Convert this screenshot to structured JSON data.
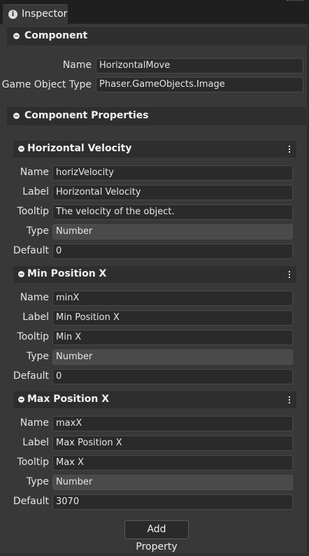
{
  "tab": {
    "label": "Inspector",
    "icon": "info-icon"
  },
  "component": {
    "title": "Component",
    "name_label": "Name",
    "name_value": "HorizontalMove",
    "type_label": "Game Object Type",
    "type_value": "Phaser.GameObjects.Image"
  },
  "properties_section": {
    "title": "Component Properties"
  },
  "properties": [
    {
      "title": "Horizontal Velocity",
      "fields": [
        {
          "label": "Name",
          "value": "horizVelocity"
        },
        {
          "label": "Label",
          "value": "Horizontal Velocity"
        },
        {
          "label": "Tooltip",
          "value": "The velocity of the object."
        },
        {
          "label": "Type",
          "value": "Number"
        },
        {
          "label": "Default",
          "value": "0"
        }
      ]
    },
    {
      "title": "Min Position X",
      "fields": [
        {
          "label": "Name",
          "value": "minX"
        },
        {
          "label": "Label",
          "value": "Min Position X"
        },
        {
          "label": "Tooltip",
          "value": "Min X"
        },
        {
          "label": "Type",
          "value": "Number"
        },
        {
          "label": "Default",
          "value": "0"
        }
      ]
    },
    {
      "title": "Max Position X",
      "fields": [
        {
          "label": "Name",
          "value": "maxX"
        },
        {
          "label": "Label",
          "value": "Max Position X"
        },
        {
          "label": "Tooltip",
          "value": "Max X"
        },
        {
          "label": "Type",
          "value": "Number"
        },
        {
          "label": "Default",
          "value": "3070"
        }
      ]
    }
  ],
  "add_property_label": "Add Property"
}
